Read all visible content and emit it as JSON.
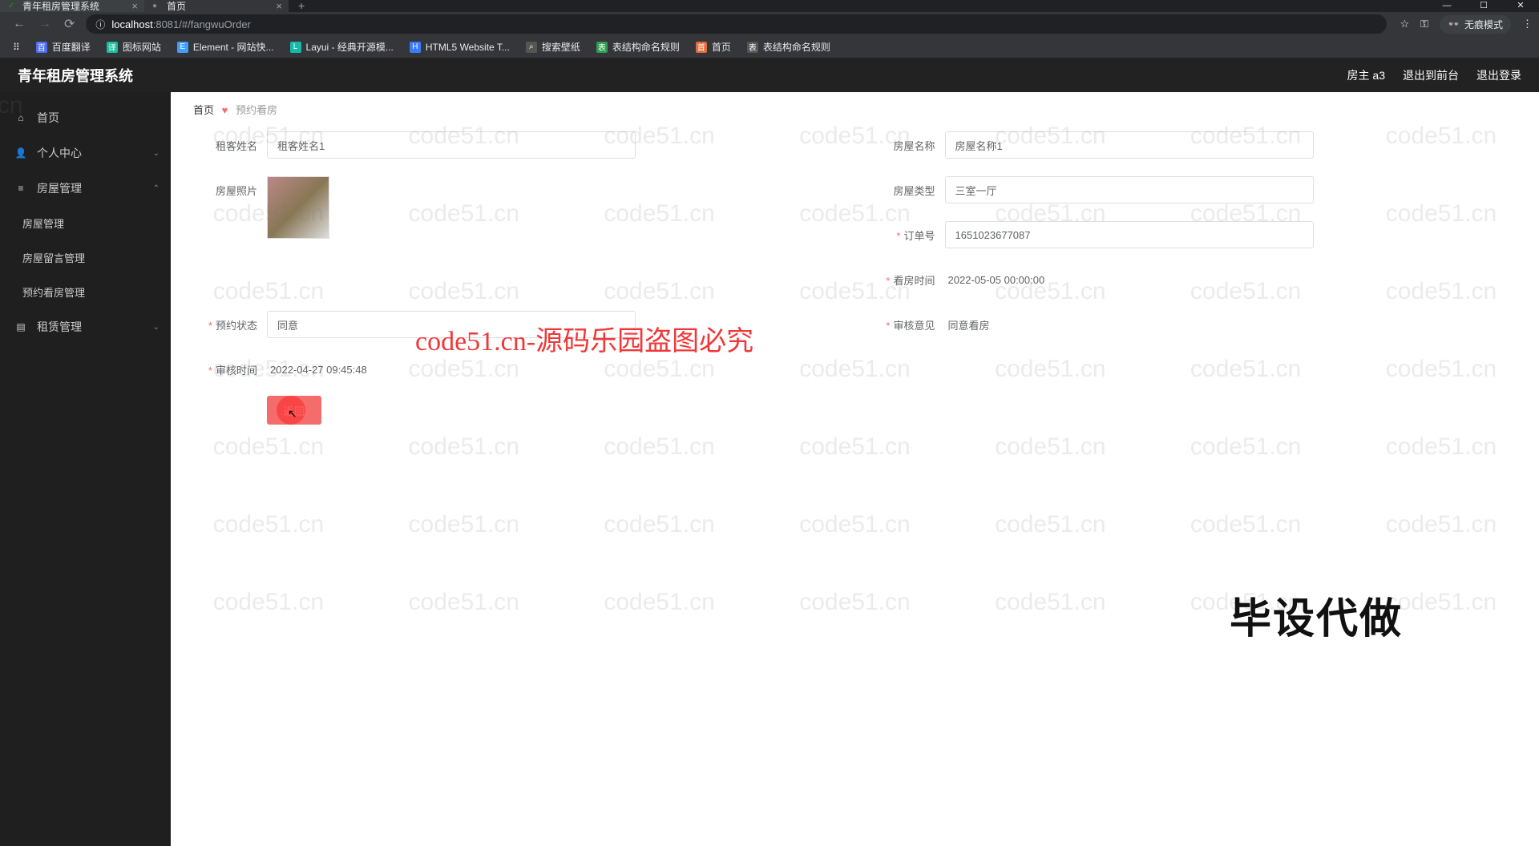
{
  "browser": {
    "tabs": [
      {
        "title": "青年租房管理系统",
        "favicon": "✓"
      },
      {
        "title": "首页",
        "favicon": "●"
      }
    ],
    "url_host": "localhost",
    "url_port": ":8081",
    "url_path": "/#/fangwuOrder",
    "incognito_label": "无痕模式",
    "bookmarks": [
      {
        "icon": "百",
        "label": "百度翻译",
        "color": "#4e6ef2"
      },
      {
        "icon": "译",
        "label": "图标网站",
        "color": "#1abc9c"
      },
      {
        "icon": "E",
        "label": "Element - 网站快...",
        "color": "#409eff"
      },
      {
        "icon": "L",
        "label": "Layui - 经典开源模...",
        "color": "#16baaa"
      },
      {
        "icon": "H",
        "label": "HTML5 Website T...",
        "color": "#3b7cff"
      },
      {
        "icon": "⌕",
        "label": "搜索壁纸",
        "color": "#555"
      },
      {
        "icon": "表",
        "label": "表结构命名规则",
        "color": "#2e9c4e"
      },
      {
        "icon": "首",
        "label": "首页",
        "color": "#e16b3b"
      },
      {
        "icon": "表",
        "label": "表结构命名规则",
        "color": "#555"
      }
    ]
  },
  "header": {
    "app_title": "青年租房管理系统",
    "owner": "房主 a3",
    "to_front": "退出到前台",
    "logout": "退出登录"
  },
  "sidebar": {
    "home": "首页",
    "personal": "个人中心",
    "house_mgmt": "房屋管理",
    "sub_house_mgmt": "房屋管理",
    "sub_house_msg": "房屋留言管理",
    "sub_booking": "预约看房管理",
    "lease_mgmt": "租赁管理"
  },
  "breadcrumb": {
    "home": "首页",
    "current": "预约看房"
  },
  "form": {
    "tenant_name_label": "租客姓名",
    "tenant_name_value": "租客姓名1",
    "house_name_label": "房屋名称",
    "house_name_value": "房屋名称1",
    "house_photo_label": "房屋照片",
    "house_type_label": "房屋类型",
    "house_type_value": "三室一厅",
    "order_no_label": "订单号",
    "order_no_value": "1651023677087",
    "view_time_label": "看房时间",
    "view_time_value": "2022-05-05 00:00:00",
    "booking_status_label": "预约状态",
    "booking_status_value": "同意",
    "audit_opinion_label": "审核意见",
    "audit_opinion_value": "同意看房",
    "audit_time_label": "审核时间",
    "audit_time_value": "2022-04-27 09:45:48",
    "back_button": "返回"
  },
  "watermarks": {
    "repeat_text": "code51.cn",
    "big_text": "code51.cn-源码乐园盗图必究",
    "corner_text": "毕设代做"
  }
}
